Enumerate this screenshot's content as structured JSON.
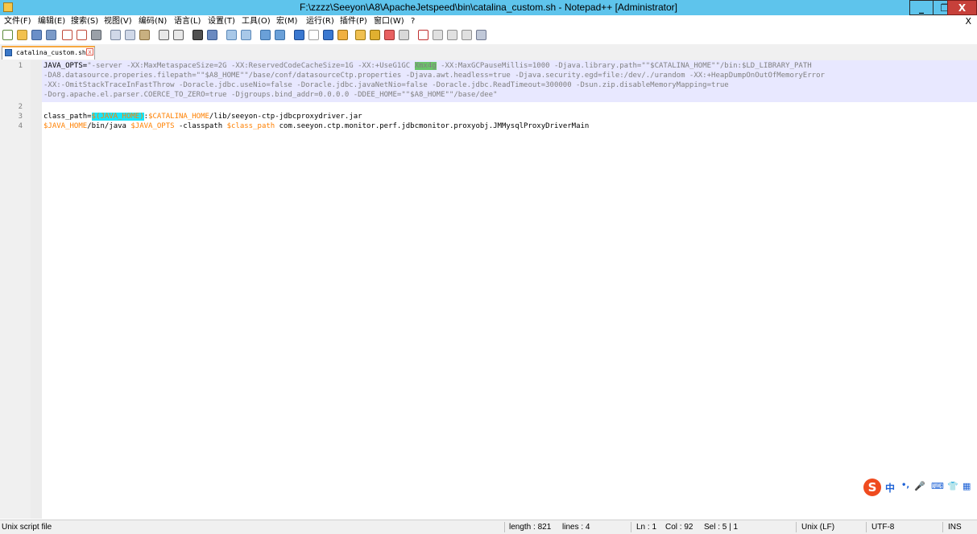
{
  "window": {
    "title": "F:\\zzzz\\Seeyon\\A8\\ApacheJetspeed\\bin\\catalina_custom.sh - Notepad++ [Administrator]",
    "minimize_label": "_",
    "maximize_label": "❐",
    "close_label": "X"
  },
  "menu": {
    "items": [
      "文件(F)",
      "编辑(E)",
      "搜索(S)",
      "视图(V)",
      "编码(N)",
      "语言(L)",
      "设置(T)",
      "工具(O)",
      "宏(M)",
      "运行(R)",
      "插件(P)",
      "窗口(W)",
      "?"
    ],
    "close_doc": "X"
  },
  "tab": {
    "label": "catalina_custom.sh",
    "close_glyph": "x"
  },
  "editor": {
    "line_numbers": [
      "1",
      "2",
      "3",
      "4"
    ],
    "line1": {
      "v1": "JAVA_OPTS=",
      "s1": "\"-server -XX:MaxMetaspaceSize=2G -XX:ReservedCodeCacheSize=1G -XX:+UseG1GC ",
      "hl": "Xmx4g",
      "s2": " -XX:MaxGCPauseMillis=1000 -Djava.library.path=\"\"$CATALINA_HOME\"\"/bin:$LD_LIBRARY_PATH",
      "wrap1": "-DA8.datasource.properies.filepath=\"\"$A8_HOME\"\"/base/conf/datasourceCtp.properties -Djava.awt.headless=true -Djava.security.egd=file:/dev/./urandom -XX:+HeapDumpOnOutOfMemoryError",
      "wrap2": "-XX:-OmitStackTraceInFastThrow -Doracle.jdbc.useNio=false -Doracle.jdbc.javaNetNio=false -Doracle.jdbc.ReadTimeout=300000 -Dsun.zip.disableMemoryMapping=true",
      "wrap3": "-Dorg.apache.el.parser.COERCE_TO_ZERO=true -Djgroups.bind_addr=0.0.0.0 -DDEE_HOME=\"\"$A8_HOME\"\"/base/dee\""
    },
    "line3": {
      "p1": "class_path=",
      "hl": "$(JAVA_HOME)",
      "p2": ":",
      "v1": "$CATALINA_HOME",
      "p3": "/lib/seeyon-ctp-jdbcproxydriver.jar"
    },
    "line4": {
      "v1": "$JAVA_HOME",
      "p1": "/bin/java ",
      "v2": "$JAVA_OPTS",
      "p2": " -classpath ",
      "v3": "$class_path",
      "p3": " com.seeyon.ctp.monitor.perf.jdbcmonitor.proxyobj.JMMysqlProxyDriverMain"
    }
  },
  "ime": {
    "logo": "S",
    "items": [
      "中",
      "•,",
      "🎤",
      "⌨",
      "👕",
      "▦"
    ]
  },
  "status": {
    "file_type": "Unix script file",
    "length": "length : 821",
    "lines": "lines : 4",
    "ln": "Ln : 1",
    "col": "Col : 92",
    "sel": "Sel : 5 | 1",
    "eol": "Unix (LF)",
    "encoding": "UTF-8",
    "mode": "INS"
  }
}
